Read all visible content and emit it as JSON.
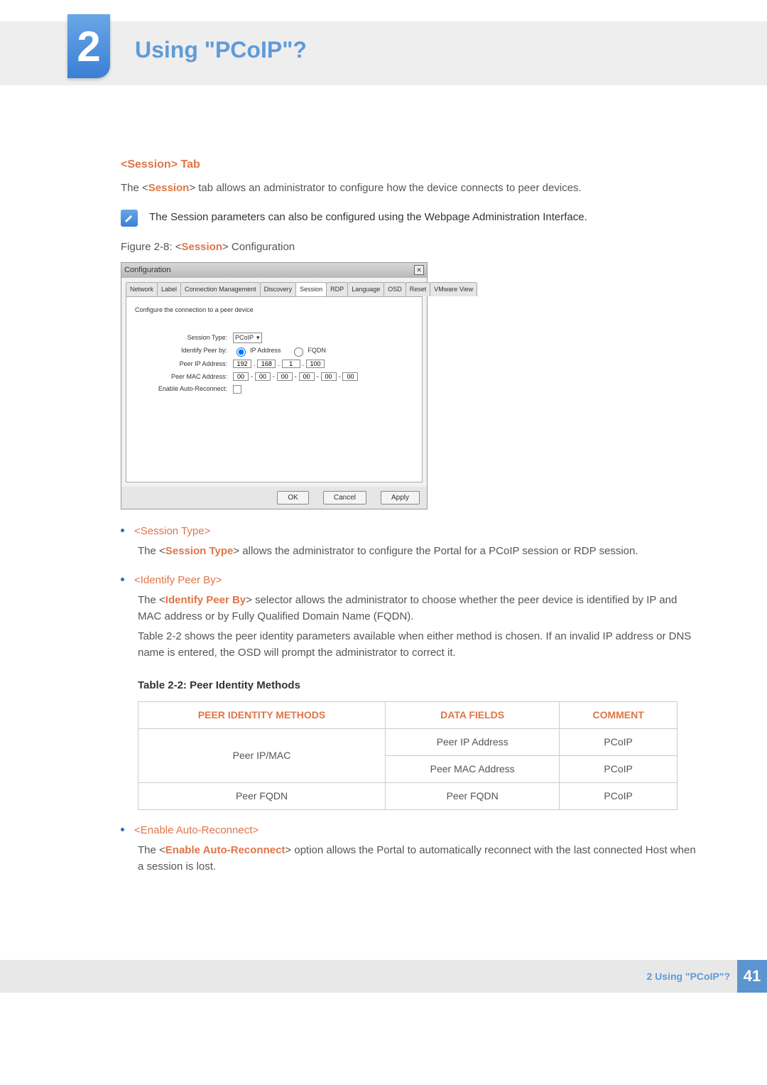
{
  "chapter": {
    "number": "2",
    "title": "Using \"PCoIP\"?"
  },
  "section": {
    "heading": "<Session> Tab",
    "intro_pre": "The <",
    "intro_hl": "Session",
    "intro_post": "> tab allows an administrator to configure how the device connects to peer devices.",
    "note": "The Session parameters can also be configured using the Webpage Administration Interface.",
    "figcap_pre": "Figure 2-8: <",
    "figcap_hl": "Session",
    "figcap_post": "> Configuration"
  },
  "cfg": {
    "title": "Configuration",
    "tabs": [
      "Network",
      "Label",
      "Connection Management",
      "Discovery",
      "Session",
      "RDP",
      "Language",
      "OSD",
      "Reset",
      "VMware View"
    ],
    "active_tab": "Session",
    "instruction": "Configure the connection to a peer device",
    "labels": {
      "session_type": "Session Type:",
      "identify": "Identify Peer by:",
      "peer_ip": "Peer IP Address:",
      "peer_mac": "Peer MAC Address:",
      "auto": "Enable Auto-Reconnect:"
    },
    "session_type_value": "PCoIP",
    "radio_ip": "IP Address",
    "radio_fqdn": "FQDN",
    "ip": [
      "192",
      "168",
      "1",
      "100"
    ],
    "mac": [
      "00",
      "00",
      "00",
      "00",
      "00",
      "00"
    ],
    "buttons": {
      "ok": "OK",
      "cancel": "Cancel",
      "apply": "Apply"
    }
  },
  "items": {
    "sessiontype": {
      "title": "<Session Type>",
      "body_pre": "The <",
      "body_hl": "Session Type",
      "body_post": "> allows the administrator to configure the Portal for a PCoIP session or RDP session."
    },
    "identify": {
      "title": "<Identify Peer By>",
      "body1_pre": "The <",
      "body1_hl": "Identify Peer By",
      "body1_post": "> selector allows the administrator to choose whether the peer device is identified by IP and MAC address or by Fully Qualified Domain Name (FQDN).",
      "body2": "Table 2-2 shows the peer identity parameters available when either method is chosen. If an invalid IP address or DNS name is entered, the OSD will prompt the administrator to correct it."
    },
    "auto": {
      "title": "<Enable Auto-Reconnect>",
      "body_pre": "The <",
      "body_hl": "Enable Auto-Reconnect",
      "body_post": "> option allows the Portal to automatically reconnect with the last connected Host when a session is lost."
    }
  },
  "table": {
    "caption": "Table 2-2: Peer Identity Methods",
    "headers": [
      "PEER IDENTITY METHODS",
      "DATA FIELDS",
      "COMMENT"
    ],
    "rows": [
      {
        "method": "Peer IP/MAC",
        "field": "Peer IP Address",
        "comment": "PCoIP",
        "rowspan": 2
      },
      {
        "method": "",
        "field": "Peer MAC Address",
        "comment": "PCoIP"
      },
      {
        "method": "Peer FQDN",
        "field": "Peer FQDN",
        "comment": "PCoIP"
      }
    ]
  },
  "footer": {
    "text": "2 Using \"PCoIP\"?",
    "page": "41"
  }
}
